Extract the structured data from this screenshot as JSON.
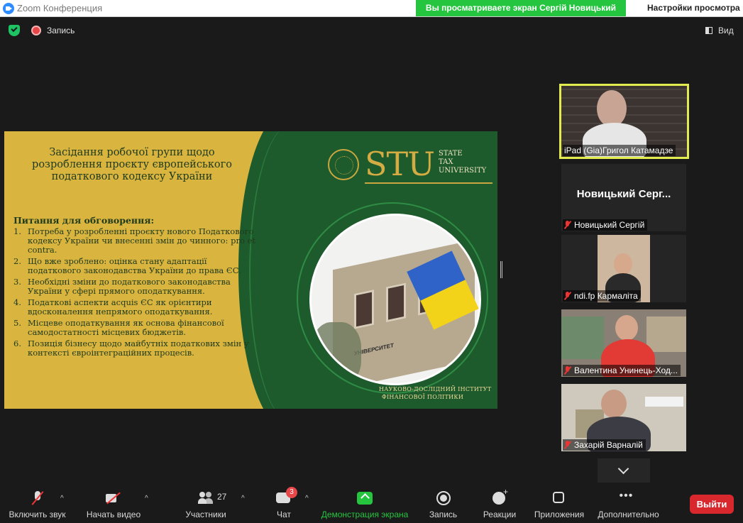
{
  "window": {
    "title": "Zoom Конференция",
    "share_banner": "Вы просматриваете экран Сергій Новицький",
    "view_options": "Настройки просмотра"
  },
  "topbar": {
    "recording_label": "Запись",
    "view_label": "Вид"
  },
  "slide": {
    "title": "Засідання робочої групи щодо розроблення проєкту європейського податкового кодексу України",
    "topics_heading": "Питання для обговорення:",
    "topics": [
      "Потреба у розробленні проєкту нового Податкового кодексу України чи внесенні змін до чинного: pro et contra.",
      "Що вже зроблено: оцінка стану адаптації податкового законодавства України до права ЄС.",
      "Необхідні зміни до податкового законодавства України у сфері прямого оподаткування.",
      "Податкові аспекти acquis ЄС як орієнтири вдосконалення непрямого оподаткування.",
      "Місцеве оподаткування як основа фінансової самодостатності місцевих бюджетів.",
      "Позиція бізнесу щодо майбутніх податкових змін у контексті євроінтеграційних процесів."
    ],
    "logo_mark": "STU",
    "logo_text_1": "STATE",
    "logo_text_2": "TAX",
    "logo_text_3": "UNIVERSITY",
    "institute_line_1": "НАУКОВО-ДОСЛІДНИЙ ІНСТИТУТ",
    "institute_line_2": "ФІНАНСОВОЇ ПОЛІТИКИ",
    "building_sign": "УНІВЕРСИТЕТ"
  },
  "participants": [
    {
      "name": "iPad (Gia)Григол Катамадзе",
      "muted": false,
      "active": true
    },
    {
      "name": "Новицький Сергій",
      "big_name": "Новицький Серг...",
      "muted": true
    },
    {
      "name": "ndi.fp Кармаліта",
      "muted": true
    },
    {
      "name": "Валентина Унинець-Ход...",
      "muted": true
    },
    {
      "name": "Захарій Варналій",
      "muted": true
    }
  ],
  "toolbar": {
    "unmute": "Включить звук",
    "start_video": "Начать видео",
    "participants": "Участники",
    "participants_count": "27",
    "chat": "Чат",
    "chat_badge": "3",
    "share_screen": "Демонстрация экрана",
    "record": "Запись",
    "reactions": "Реакции",
    "apps": "Приложения",
    "more": "Дополнительно",
    "leave": "Выйти"
  },
  "colors": {
    "share_green": "#26c540",
    "leave_red": "#d9272e",
    "slide_gold": "#d9b43f",
    "slide_green": "#1d5a2c",
    "active_speaker": "#e3ec4e"
  }
}
